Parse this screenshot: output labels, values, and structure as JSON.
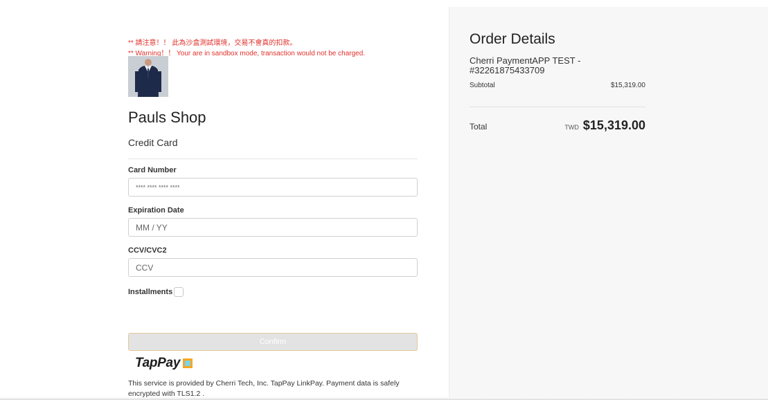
{
  "notice": {
    "warning_zh": "** 請注意！！ 此為沙盒測試環境，交易不會真的扣款。",
    "warning_en": "** Warning！！ Your are in sandbox mode, transaction would not be charged."
  },
  "shop": {
    "name": "Pauls Shop",
    "payment_method": "Credit Card"
  },
  "form": {
    "card_number_label": "Card Number",
    "card_number_placeholder": "**** **** **** ****",
    "expiration_label": "Expiration Date",
    "expiration_placeholder": "MM / YY",
    "ccv_label": "CCV/CVC2",
    "ccv_placeholder": "CCV",
    "installments_label": "Installments",
    "confirm_label": "Confirm"
  },
  "provider": {
    "logo_text": "TapPay",
    "notice": "This service is provided by Cherri Tech, Inc. TapPay LinkPay. Payment data is safely encrypted with TLS1.2 ."
  },
  "order": {
    "title": "Order Details",
    "name": "Cherri PaymentAPP TEST - #32261875433709",
    "subtotal_label": "Subtotal",
    "subtotal_value": "$15,319.00",
    "total_label": "Total",
    "total_currency": "TWD",
    "total_value": "$15,319.00"
  },
  "colors": {
    "warning": "#e0312b",
    "panel": "#f7f7f7",
    "logo_accent": "#f5a623"
  }
}
